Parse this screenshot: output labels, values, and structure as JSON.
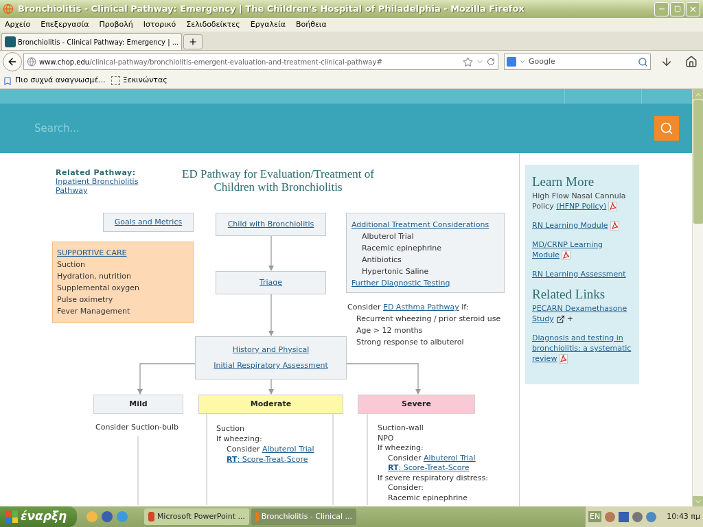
{
  "window": {
    "title": "Bronchiolitis - Clinical Pathway: Emergency | The Children's Hospital of Philadelphia - Mozilla Firefox"
  },
  "menu": [
    "Αρχείο",
    "Επεξεργασία",
    "Προβολή",
    "Ιστορικό",
    "Σελιδοδείκτες",
    "Εργαλεία",
    "Βοήθεια"
  ],
  "tabs": [
    {
      "label": "Bronchiolitis - Clinical Pathway: Emergency | ...",
      "selected": true
    }
  ],
  "address_bar": {
    "domain": "www.chop.edu",
    "path": "/clinical-pathway/bronchiolitis-emergent-evaluation-and-treatment-clinical-pathway#"
  },
  "search_box": {
    "placeholder": "Google"
  },
  "bookmarks": [
    "Πιο συχνά αναγνωσμέ...",
    "Ξεκινώντας"
  ],
  "site_search": {
    "placeholder": "Search..."
  },
  "related_pathway": {
    "label": "Related Pathway:",
    "link": "Inpatient Bronchiolitis Pathway"
  },
  "pathway_title": [
    "ED Pathway for Evaluation/Treatment of",
    "Children with Bronchiolitis"
  ],
  "goals_link": "Goals and Metrics",
  "start_node": "Child with Bronchiolitis",
  "supportive_care": {
    "heading": "SUPPORTIVE CARE",
    "items": [
      "Suction",
      "Hydration, nutrition",
      "Supplemental oxygen",
      "Pulse oximetry",
      "Fever Management"
    ]
  },
  "triage": "Triage",
  "additional": {
    "heading": "Additional Treatment Considerations",
    "items": [
      "Albuterol Trial",
      "Racemic epinephrine",
      "Antibiotics",
      "Hypertonic Saline"
    ],
    "footer_link": "Further Diagnostic Testing"
  },
  "asthma": {
    "prefix": "Consider",
    "link": "ED Asthma Pathway",
    "suffix": "if:",
    "criteria": [
      "Recurrent wheezing / prior steroid use",
      "Age > 12 months",
      "Strong response to albuterol"
    ]
  },
  "assessment": [
    "History and Physical",
    "Initial Respiratory Assessment"
  ],
  "severity": [
    {
      "label": "Mild",
      "color": "#eff3f5",
      "lines": [
        {
          "text": "Consider Suction-bulb"
        }
      ]
    },
    {
      "label": "Moderate",
      "color": "#fdf9a6",
      "lines": [
        {
          "text": "Suction"
        },
        {
          "text": "If wheezing:",
          "children": [
            {
              "text": "Consider",
              "link": "Albuterol Trial"
            },
            {
              "link": "**RT**: Score-Treat-Score"
            }
          ]
        }
      ]
    },
    {
      "label": "Severe",
      "color": "#f9c9d5",
      "lines": [
        {
          "text": "Suction-wall"
        },
        {
          "text": "NPO"
        },
        {
          "text": "If wheezing:",
          "children": [
            {
              "text": "Consider",
              "link": "Albuterol Trial"
            },
            {
              "link": "**RT**: Score-Treat-Score"
            }
          ]
        },
        {
          "text": "If severe respiratory distress:",
          "children": [
            {
              "text": "Consider:"
            },
            {
              "text": "Racemic epinephrine"
            }
          ]
        }
      ]
    }
  ],
  "learn_more": {
    "heading": "Learn More",
    "items": [
      {
        "kind": "pdf",
        "text": "High Flow Nasal Cannula Policy",
        "link": "(HFNP Policy)"
      },
      {
        "kind": "pdf",
        "link": "RN Learning Module"
      },
      {
        "kind": "pdf",
        "link": "MD/CRNP Learning Module"
      },
      {
        "kind": "plain",
        "link": "RN Learning Assessment"
      }
    ]
  },
  "related_links": {
    "heading": "Related Links",
    "items": [
      {
        "kind": "external",
        "link": "PECARN Dexamethasone Study",
        "suffix": "+"
      },
      {
        "kind": "pdf",
        "link": "Diagnosis and testing in bronchiolitis: a systematic review"
      }
    ]
  },
  "taskbar": {
    "start": "έναρξη",
    "tasks": [
      {
        "label": "Microsoft PowerPoint ...",
        "selected": false
      },
      {
        "label": "Bronchiolitis - Clinical ...",
        "selected": true
      }
    ],
    "language": "EN",
    "clock": "10:43 πμ"
  }
}
